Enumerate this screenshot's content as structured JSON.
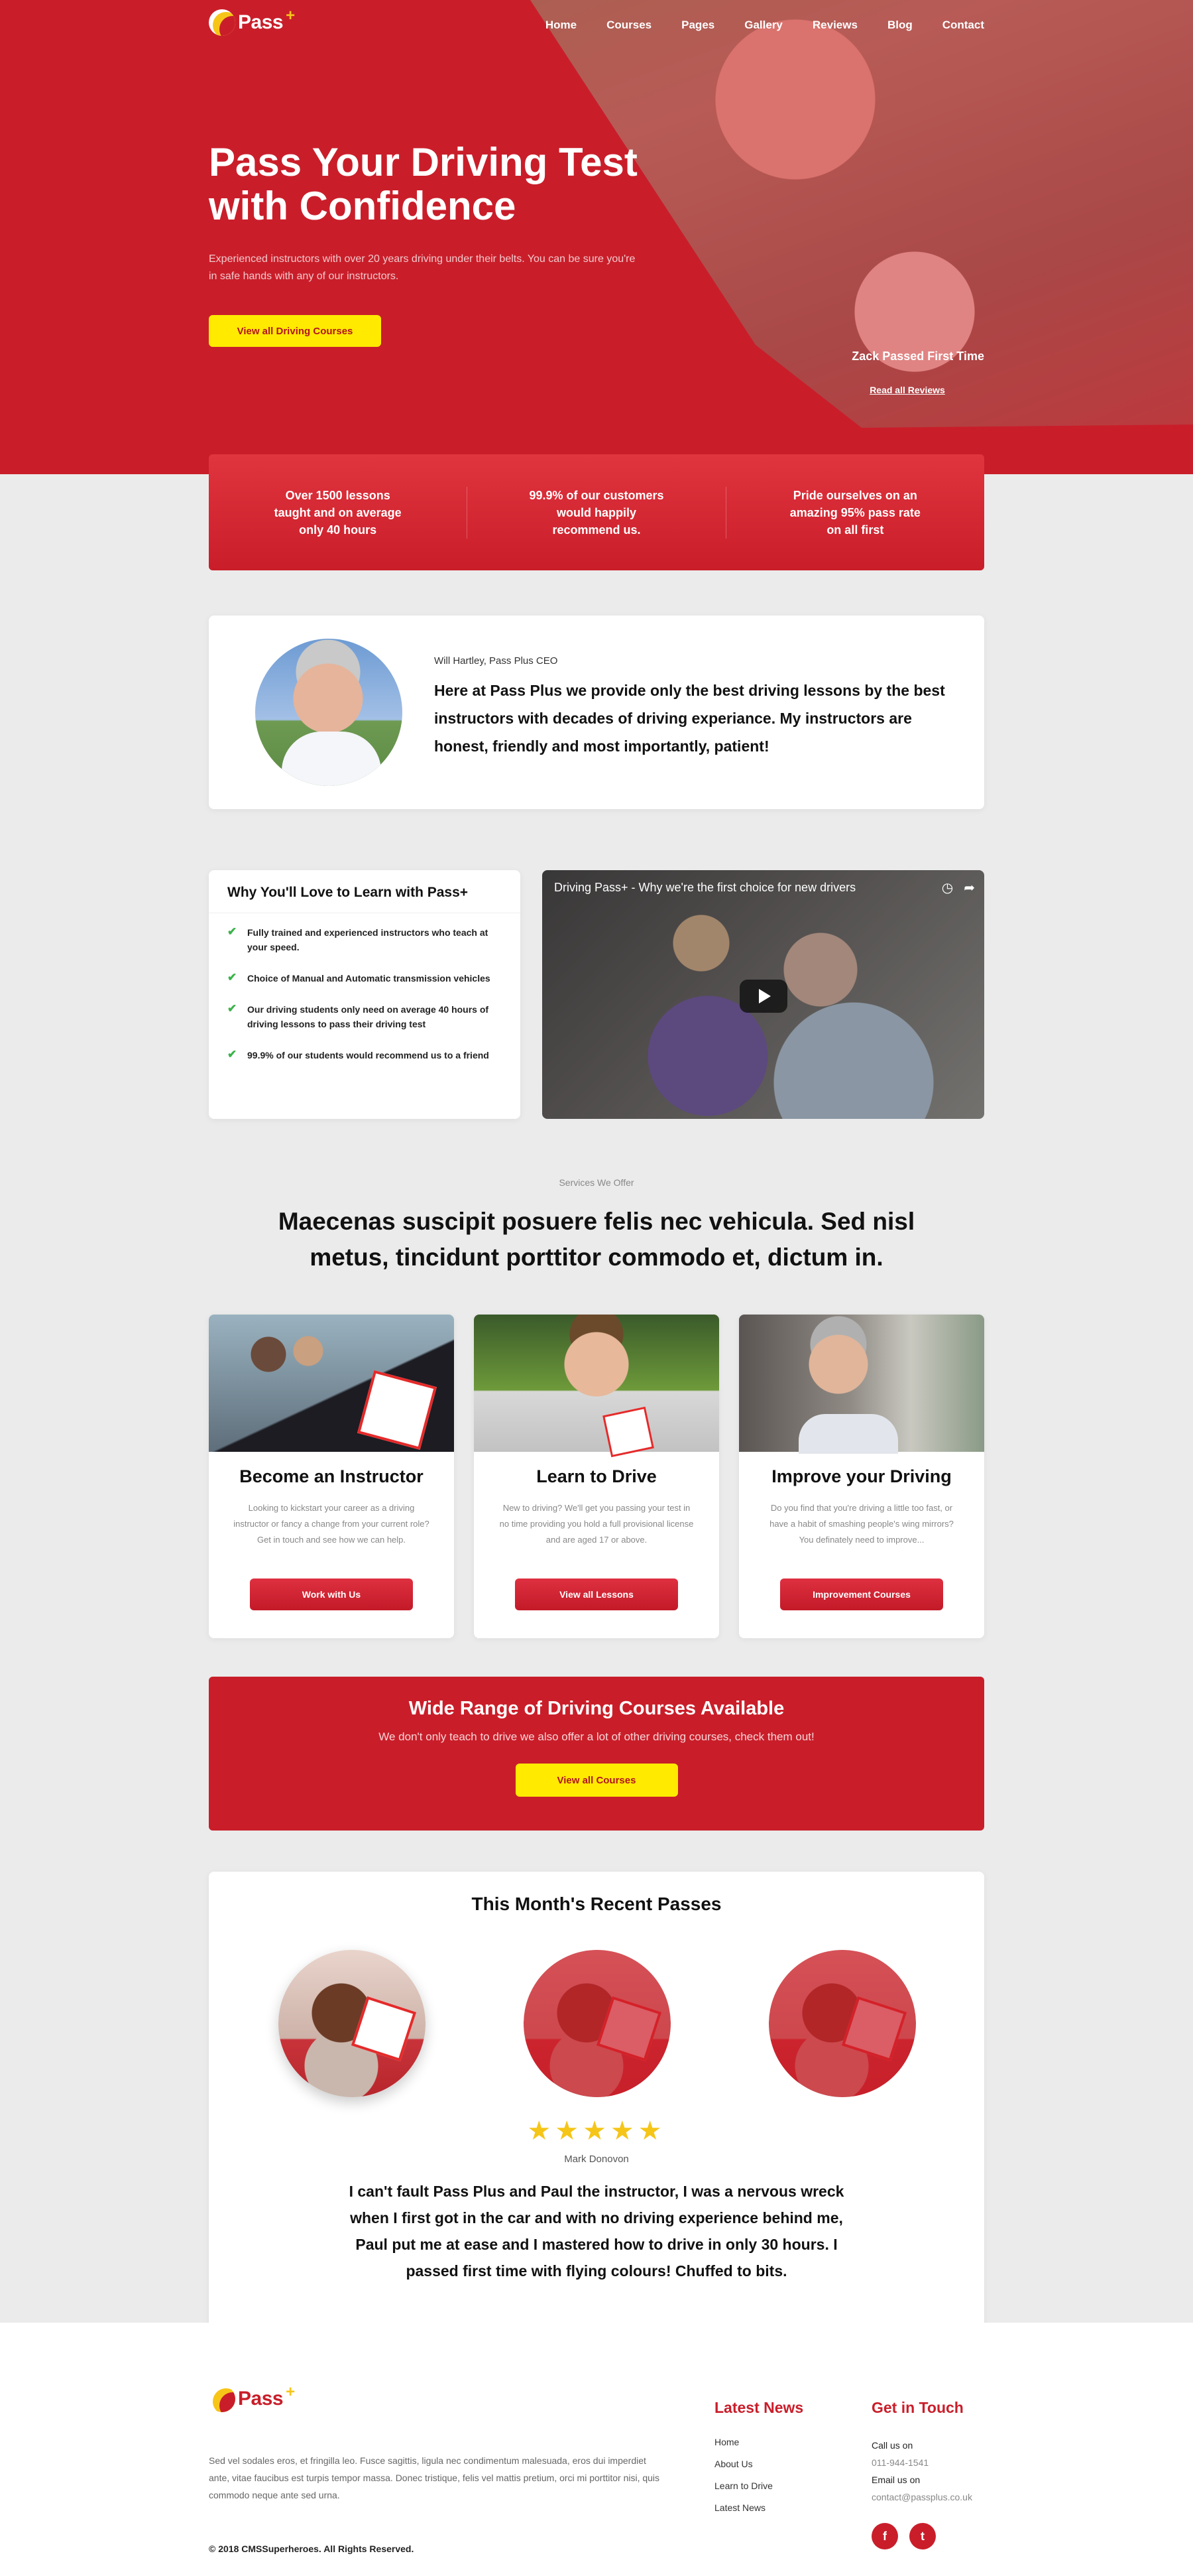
{
  "brand": {
    "name": "Pass",
    "plus": "+"
  },
  "nav": {
    "items": [
      "Home",
      "Courses",
      "Pages",
      "Gallery",
      "Reviews",
      "Blog",
      "Contact"
    ]
  },
  "hero": {
    "title": "Pass Your Driving Test with Confidence",
    "subtitle": "Experienced instructors with over 20 years driving under their belts. You can be sure you're in safe hands with any of our instructors.",
    "button": "View all Driving Courses",
    "caption": "Zack Passed First Time",
    "reviews_link": "Read all Reviews"
  },
  "stats": [
    "Over 1500 lessons taught and on average only 40 hours",
    "99.9% of our customers would happily recommend us.",
    "Pride ourselves on an amazing 95% pass rate on all first"
  ],
  "ceo": {
    "name": "Will Hartley, Pass Plus CEO",
    "quote": "Here at Pass Plus we provide only the best driving lessons by the best instructors with decades of driving experiance. My instructors are honest, friendly and most importantly, patient!"
  },
  "why": {
    "title": "Why You'll Love to Learn with Pass+",
    "items": [
      "Fully trained and experienced instructors who teach at your speed.",
      "Choice of Manual and Automatic transmission vehicles",
      "Our driving students only need on average 40 hours of driving lessons to pass their driving test",
      "99.9% of our students would recommend us to a friend"
    ]
  },
  "video": {
    "title": "Driving Pass+ - Why we're the first choice for new drivers",
    "icons": [
      "clock-icon",
      "share-icon",
      "play-icon"
    ]
  },
  "services": {
    "eyebrow": "Services We Offer",
    "heading": "Maecenas suscipit posuere felis nec vehicula. Sed nisl metus, tincidunt porttitor commodo et, dictum in.",
    "cards": [
      {
        "title": "Become an Instructor",
        "text": "Looking to kickstart your career as a driving instructor or fancy a change from your current role? Get in touch and see how we can help.",
        "button": "Work with Us"
      },
      {
        "title": "Learn to Drive",
        "text": "New to driving? We'll get you passing your test in no time providing you hold a full provisional license and are aged 17 or above.",
        "button": "View all Lessons"
      },
      {
        "title": "Improve your Driving",
        "text": "Do you find that you're driving a little too fast, or have a habit of smashing people's wing mirrors? You definately need to improve...",
        "button": "Improvement Courses"
      }
    ]
  },
  "cta": {
    "title": "Wide Range of Driving Courses Available",
    "text": "We don't only teach to drive we also offer a lot of other driving courses, check them out!",
    "button": "View all Courses"
  },
  "passes": {
    "title": "This Month's Recent Passes",
    "stars": "★★★★★",
    "rating": 5,
    "reviewer": "Mark Donovon",
    "review": "I can't fault Pass Plus and Paul the instructor, I was a nervous wreck when I first got in the car and with no driving experience behind me, Paul put me at ease and I mastered how to drive in only 30 hours. I passed first time with flying colours! Chuffed to bits."
  },
  "footer": {
    "about": "Sed vel sodales eros, et fringilla leo. Fusce sagittis, ligula nec condimentum malesuada, eros dui imperdiet ante, vitae faucibus est turpis tempor massa. Donec tristique, felis vel mattis pretium, orci mi porttitor nisi, quis commodo neque ante sed urna.",
    "copyright": "© 2018 CMSSuperheroes. All Rights Reserved.",
    "news_title": "Latest News",
    "news_links": [
      "Home",
      "About Us",
      "Learn to Drive",
      "Latest News"
    ],
    "contact_title": "Get in Touch",
    "call_label": "Call us on",
    "phone": "011-944-1541",
    "email_label": "Email us on",
    "email": "contact@passplus.co.uk",
    "social": {
      "facebook": "f",
      "twitter": "t"
    }
  },
  "colors": {
    "brand_red": "#c91e2a",
    "accent_yellow": "#ffea00",
    "check_green": "#3bb34a",
    "star_gold": "#f5c518"
  }
}
